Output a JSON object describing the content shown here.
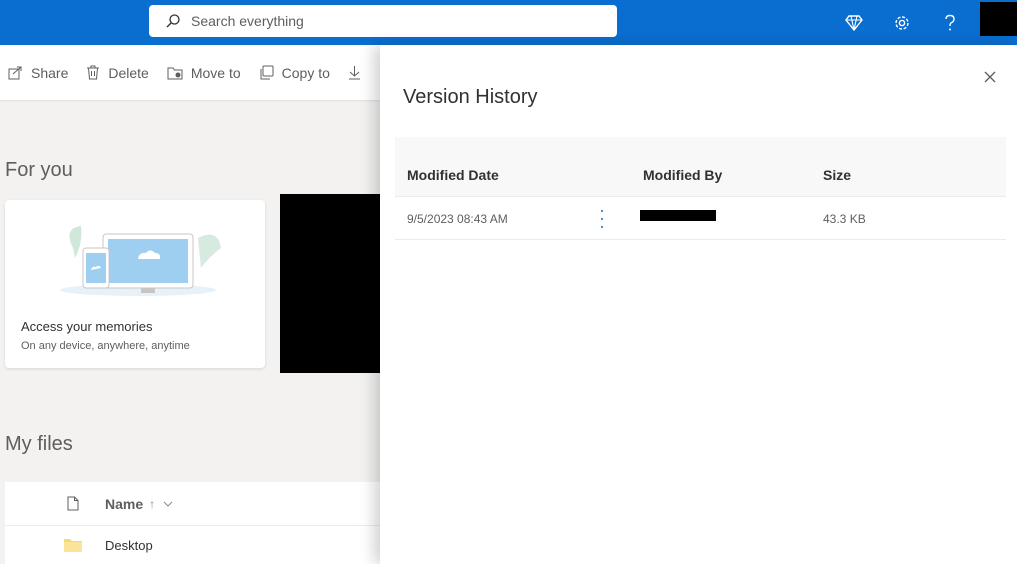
{
  "header": {
    "search_placeholder": "Search everything",
    "icons": [
      "premium-diamond-icon",
      "settings-gear-icon",
      "help-question-icon"
    ]
  },
  "commandbar": {
    "share": "Share",
    "delete": "Delete",
    "move_to": "Move to",
    "copy_to": "Copy to"
  },
  "for_you": {
    "title": "For you",
    "card_title": "Access your memories",
    "card_subtitle": "On any device, anywhere, anytime"
  },
  "my_files": {
    "title": "My files",
    "name_header": "Name",
    "sort_indicator": "↑",
    "rows": [
      {
        "name": "Desktop"
      }
    ]
  },
  "version_history": {
    "title": "Version History",
    "columns": {
      "modified_date": "Modified Date",
      "modified_by": "Modified By",
      "size": "Size"
    },
    "rows": [
      {
        "modified_date": "9/5/2023 08:43 AM",
        "size": "43.3 KB"
      }
    ]
  },
  "colors": {
    "accent": "#0a6ed1",
    "folder": "#f8d775"
  }
}
